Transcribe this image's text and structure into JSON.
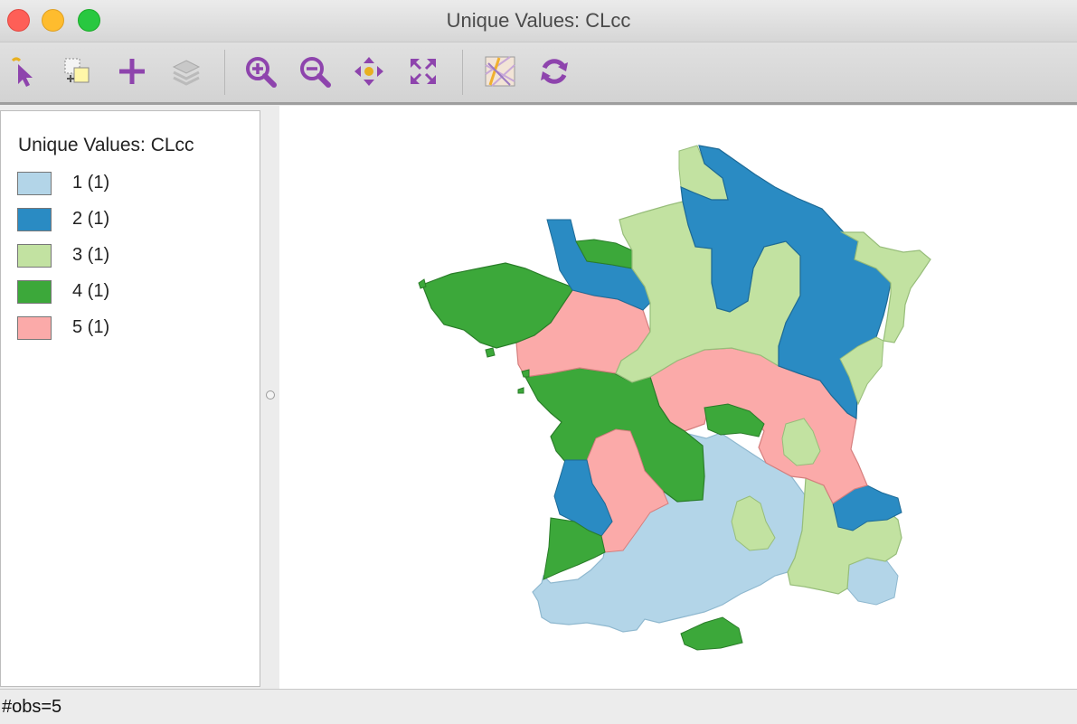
{
  "window": {
    "title": "Unique Values: CLcc"
  },
  "toolbar": {
    "tools": [
      {
        "name": "select-tool-icon"
      },
      {
        "name": "selection-shape-icon"
      },
      {
        "name": "add-icon"
      },
      {
        "name": "layers-icon"
      },
      {
        "name": "zoom-in-icon"
      },
      {
        "name": "zoom-out-icon"
      },
      {
        "name": "pan-icon"
      },
      {
        "name": "full-extent-icon"
      },
      {
        "name": "basemap-icon"
      },
      {
        "name": "refresh-icon"
      }
    ]
  },
  "legend": {
    "title": "Unique Values: CLcc",
    "items": [
      {
        "label": "1 (1)",
        "color": "#b3d5e8"
      },
      {
        "label": "2 (1)",
        "color": "#2a8bc3"
      },
      {
        "label": "3 (1)",
        "color": "#c2e2a1"
      },
      {
        "label": "4 (1)",
        "color": "#3ca83a"
      },
      {
        "label": "5 (1)",
        "color": "#fbaaa9"
      }
    ]
  },
  "status": {
    "text": "#obs=5"
  }
}
